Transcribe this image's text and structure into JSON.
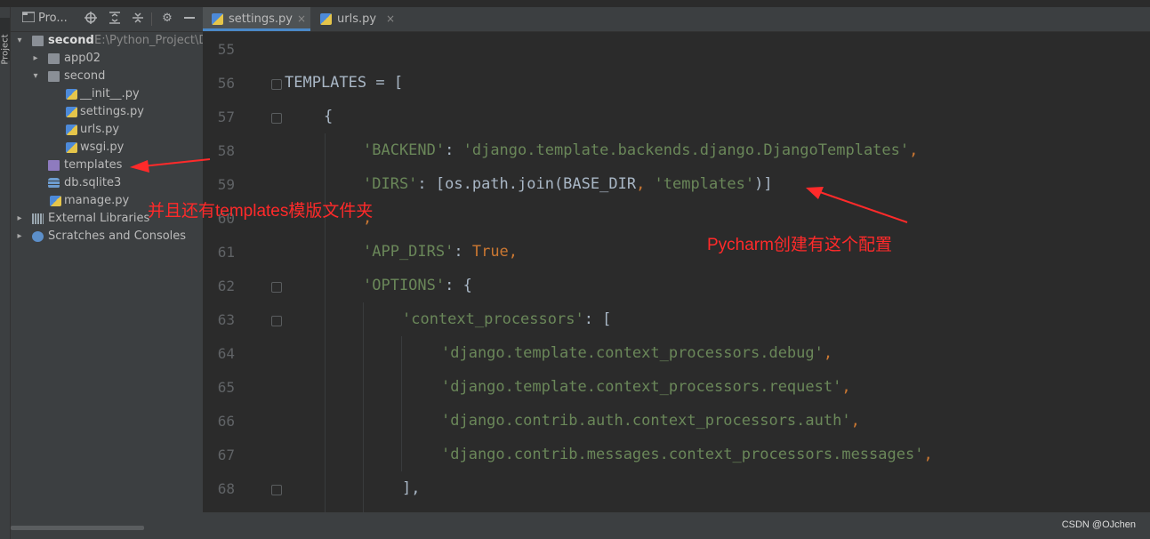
{
  "project_panel": {
    "title": "Pro...",
    "tree": [
      {
        "label": "second",
        "path": "E:\\Python_Project\\D",
        "expanded": true
      },
      {
        "label": "app02",
        "expanded": false
      },
      {
        "label": "second",
        "expanded": true
      },
      {
        "label": "__init__.py"
      },
      {
        "label": "settings.py"
      },
      {
        "label": "urls.py"
      },
      {
        "label": "wsgi.py"
      },
      {
        "label": "templates"
      },
      {
        "label": "db.sqlite3"
      },
      {
        "label": "manage.py"
      },
      {
        "label": "External Libraries",
        "expanded": false
      },
      {
        "label": "Scratches and Consoles",
        "expanded": false
      }
    ]
  },
  "side_stripe": {
    "label": "Project"
  },
  "tabs": [
    {
      "label": "settings.py",
      "active": true,
      "close": "×"
    },
    {
      "label": "urls.py",
      "active": false,
      "close": "×"
    }
  ],
  "editor": {
    "lines": [
      {
        "number": "55"
      },
      {
        "number": "56"
      },
      {
        "number": "57"
      },
      {
        "number": "58"
      },
      {
        "number": "59"
      },
      {
        "number": "60"
      },
      {
        "number": "61"
      },
      {
        "number": "62"
      },
      {
        "number": "63"
      },
      {
        "number": "64"
      },
      {
        "number": "65"
      },
      {
        "number": "66"
      },
      {
        "number": "67"
      },
      {
        "number": "68"
      }
    ],
    "code": {
      "l56": "TEMPLATES = [",
      "l57": "{",
      "l58_key": "'BACKEND'",
      "l58_sep": ": ",
      "l58_val": "'django.template.backends.django.DjangoTemplates'",
      "l58_comma": ",",
      "l59_key": "'DIRS'",
      "l59_mid": ": [os.path.join(BASE_DIR",
      "l59_comma": ", ",
      "l59_val": "'templates'",
      "l59_end": ")]",
      "l60": ",",
      "l61_key": "'APP_DIRS'",
      "l61_sep": ": ",
      "l61_val": "True",
      "l61_comma": ",",
      "l62_key": "'OPTIONS'",
      "l62_sep": ": {",
      "l63_key": "'context_processors'",
      "l63_sep": ": [",
      "l64": "'django.template.context_processors.debug'",
      "l65": "'django.template.context_processors.request'",
      "l66": "'django.contrib.auth.context_processors.auth'",
      "l67": "'django.contrib.messages.context_processors.messages'",
      "comma": ",",
      "l68": "],"
    }
  },
  "annotations": {
    "templates_note": "并且还有templates模版文件夹",
    "config_note": "Pycharm创建有这个配置",
    "color": "#ff2a2a"
  },
  "watermark": "CSDN @OJchen",
  "colors": {
    "editor_bg": "#2b2b2b",
    "panel_bg": "#3c3f41",
    "string": "#6a8759",
    "keyword": "#cc7832",
    "text": "#a9b7c6",
    "line_number": "#606366",
    "tab_underline": "#4a88c7"
  },
  "icons": {
    "locate": "crosshair-icon",
    "expand_all": "expand-all-icon",
    "collapse_all": "collapse-all-icon",
    "settings": "gear-icon",
    "hide": "minimize-icon"
  }
}
